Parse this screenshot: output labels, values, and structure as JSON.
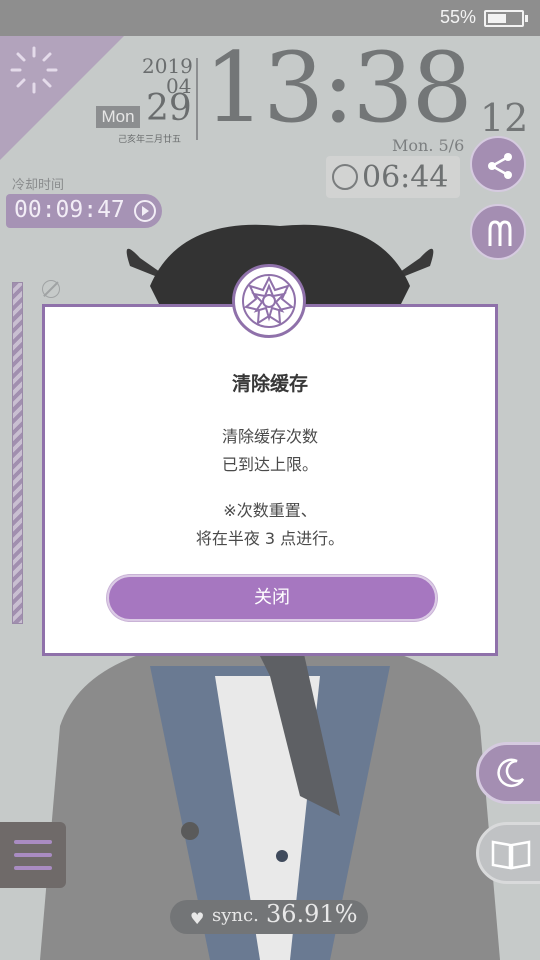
{
  "status_bar": {
    "battery_percent": "55%",
    "battery_level": 0.55
  },
  "clock": {
    "year": "2019",
    "month": "04",
    "day": "29",
    "weekday": "Mon",
    "lunar": "己亥年三月廿五",
    "time": "13:38",
    "seconds": "12"
  },
  "alarm": {
    "date": "Mon.  5/6",
    "time": "06:44"
  },
  "cooldown": {
    "label": "冷却时间",
    "value": "00:09:47"
  },
  "dialog": {
    "title": "清除缓存",
    "line1": "清除缓存次数",
    "line2": "已到达上限。",
    "line3": "※次数重置、",
    "line4": "将在半夜 3 点进行。",
    "close_label": "关闭"
  },
  "sync": {
    "label": "sync.",
    "value": "36.91%"
  },
  "colors": {
    "accent": "#a677c0",
    "dialog_border": "#8f71aa",
    "status_bar": "#8e8e8e"
  },
  "icons": [
    "spinner-icon",
    "share-icon",
    "m-icon",
    "alarm-icon",
    "play-icon",
    "no-entry-icon",
    "emblem-icon",
    "menu-icon",
    "moon-icon",
    "book-icon",
    "heart-icon"
  ]
}
